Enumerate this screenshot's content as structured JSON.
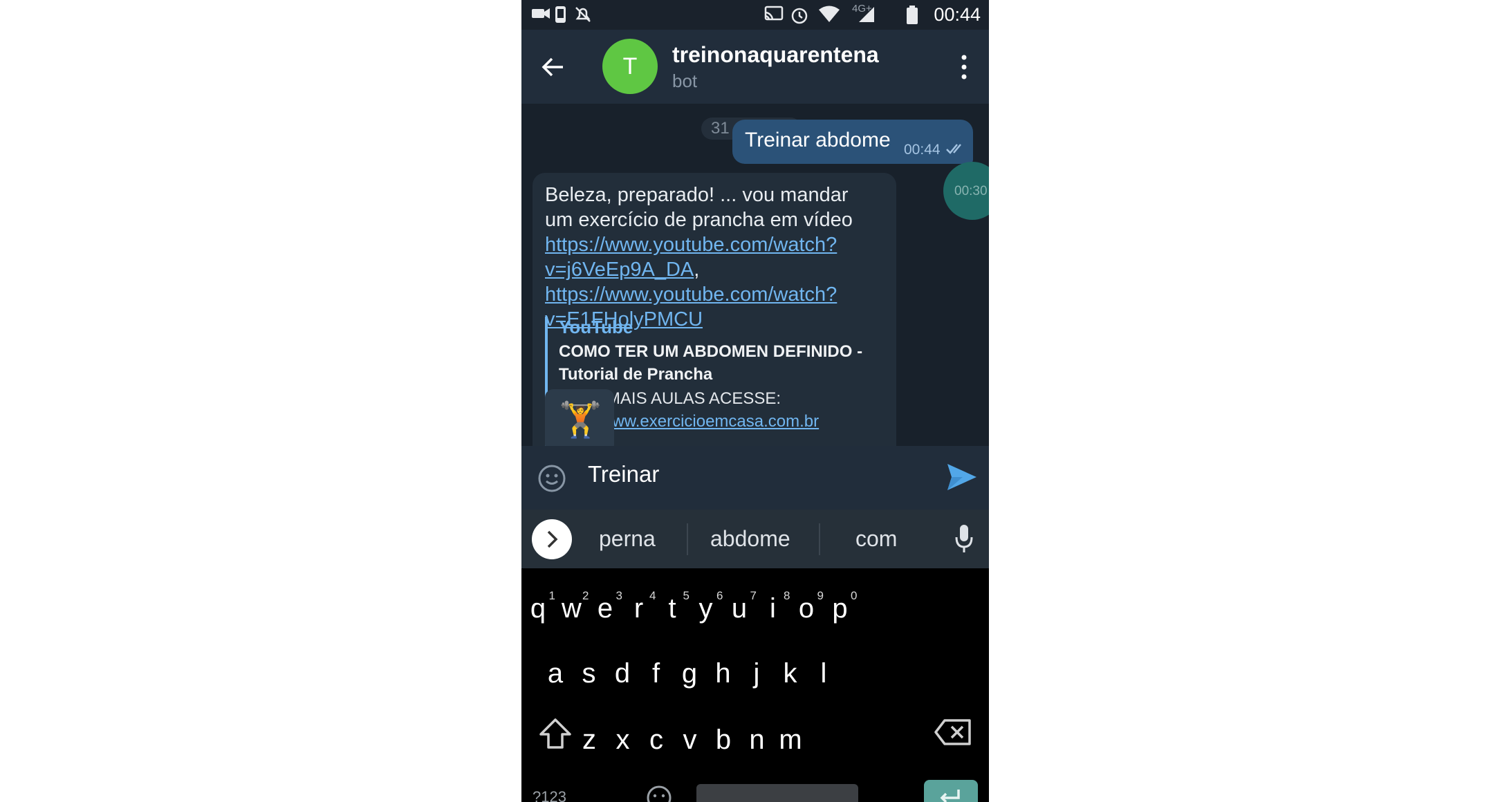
{
  "status_bar": {
    "time": "00:44",
    "network": "4G+",
    "icons": [
      "video-camera-icon",
      "phone-icon",
      "notifications-off-icon",
      "cast-icon",
      "alarm-icon",
      "wifi-icon",
      "signal-icon",
      "battery-icon"
    ]
  },
  "header": {
    "avatar_letter": "T",
    "title": "treinonaquarentena",
    "subtitle": "bot",
    "colors": {
      "avatar": "#5fc743",
      "background": "#212d3b"
    }
  },
  "chat": {
    "date_chip": "31 de julho",
    "outgoing": {
      "text": "Treinar abdome",
      "time": "00:44"
    },
    "video_time": "00:30",
    "incoming": {
      "text_line1": "Beleza, preparado! ... vou mandar",
      "text_line2": "um exercício de prancha em vídeo",
      "link1": "https://www.youtube.com/watch?v=j6VeEp9A_DA",
      "separator": ", ",
      "link2": "https://www.youtube.com/watch?v=E1FHolyPMCU",
      "preview": {
        "site": "YouTube",
        "title": "COMO TER UM ABDOMEN DEFINIDO - Tutorial de Prancha",
        "description": "PARA MAIS AULAS ACESSE:",
        "link": "http://www.exercicioemcasa.com.br"
      }
    },
    "sticker": "🏋️"
  },
  "input": {
    "value": "Treinar"
  },
  "suggestions": [
    "perna",
    "abdome",
    "com"
  ],
  "keyboard": {
    "row1": [
      {
        "k": "q",
        "n": "1"
      },
      {
        "k": "w",
        "n": "2"
      },
      {
        "k": "e",
        "n": "3"
      },
      {
        "k": "r",
        "n": "4"
      },
      {
        "k": "t",
        "n": "5"
      },
      {
        "k": "y",
        "n": "6"
      },
      {
        "k": "u",
        "n": "7"
      },
      {
        "k": "i",
        "n": "8"
      },
      {
        "k": "o",
        "n": "9"
      },
      {
        "k": "p",
        "n": "0"
      }
    ],
    "row2": [
      "a",
      "s",
      "d",
      "f",
      "g",
      "h",
      "j",
      "k",
      "l"
    ],
    "row3": [
      "z",
      "x",
      "c",
      "v",
      "b",
      "n",
      "m"
    ],
    "symbols_label": "?123"
  }
}
